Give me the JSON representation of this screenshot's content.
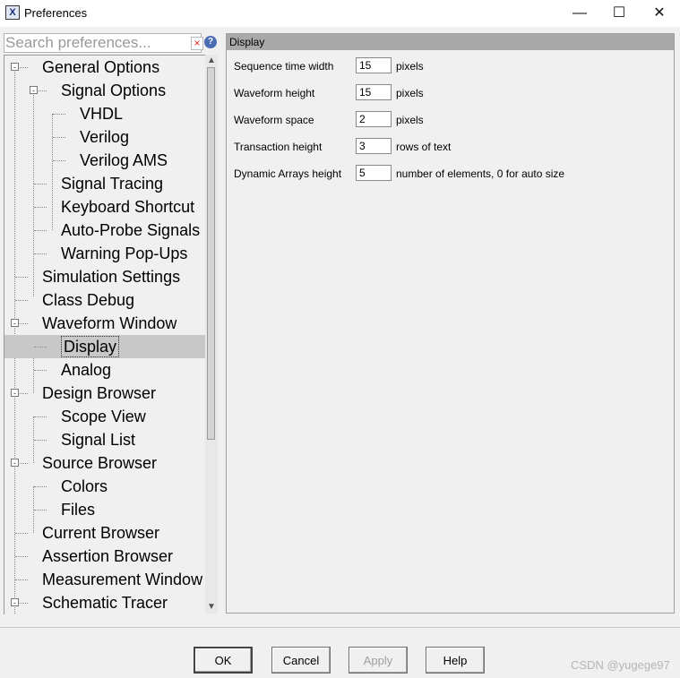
{
  "window": {
    "title": "Preferences",
    "min": "—",
    "max": "☐",
    "close": "✕",
    "icon": "X"
  },
  "search": {
    "placeholder": "Search preferences...",
    "clear": "×",
    "help": "?"
  },
  "tree": [
    {
      "label": "General Options",
      "level": 0,
      "toggle": "-"
    },
    {
      "label": "Signal Options",
      "level": 1,
      "toggle": "-"
    },
    {
      "label": "VHDL",
      "level": 2,
      "toggle": ""
    },
    {
      "label": "Verilog",
      "level": 2,
      "toggle": ""
    },
    {
      "label": "Verilog AMS",
      "level": 2,
      "toggle": ""
    },
    {
      "label": "Signal Tracing",
      "level": 1,
      "toggle": ""
    },
    {
      "label": "Keyboard Shortcut",
      "level": 1,
      "toggle": ""
    },
    {
      "label": "Auto-Probe Signals",
      "level": 1,
      "toggle": ""
    },
    {
      "label": "Warning Pop-Ups",
      "level": 1,
      "toggle": ""
    },
    {
      "label": "Simulation Settings",
      "level": 0,
      "toggle": ""
    },
    {
      "label": "Class Debug",
      "level": 0,
      "toggle": ""
    },
    {
      "label": "Waveform Window",
      "level": 0,
      "toggle": "-"
    },
    {
      "label": "Display",
      "level": 1,
      "toggle": "",
      "selected": true
    },
    {
      "label": "Analog",
      "level": 1,
      "toggle": ""
    },
    {
      "label": "Design Browser",
      "level": 0,
      "toggle": "-"
    },
    {
      "label": "Scope View",
      "level": 1,
      "toggle": ""
    },
    {
      "label": "Signal List",
      "level": 1,
      "toggle": ""
    },
    {
      "label": "Source Browser",
      "level": 0,
      "toggle": "-"
    },
    {
      "label": "Colors",
      "level": 1,
      "toggle": ""
    },
    {
      "label": "Files",
      "level": 1,
      "toggle": ""
    },
    {
      "label": "Current Browser",
      "level": 0,
      "toggle": ""
    },
    {
      "label": "Assertion Browser",
      "level": 0,
      "toggle": ""
    },
    {
      "label": "Measurement Window",
      "level": 0,
      "toggle": ""
    },
    {
      "label": "Schematic Tracer",
      "level": 0,
      "toggle": "-"
    }
  ],
  "panel": {
    "title": "Display",
    "rows": [
      {
        "label": "Sequence time width",
        "value": "15",
        "unit": "pixels"
      },
      {
        "label": "Waveform height",
        "value": "15",
        "unit": "pixels"
      },
      {
        "label": "Waveform space",
        "value": "2",
        "unit": "pixels"
      },
      {
        "label": "Transaction height",
        "value": "3",
        "unit": "rows of text"
      },
      {
        "label": "Dynamic Arrays height",
        "value": "5",
        "unit": "number of elements, 0 for auto size"
      }
    ]
  },
  "buttons": {
    "ok": "OK",
    "cancel": "Cancel",
    "apply": "Apply",
    "help": "Help"
  },
  "watermark": "CSDN @yugege97"
}
